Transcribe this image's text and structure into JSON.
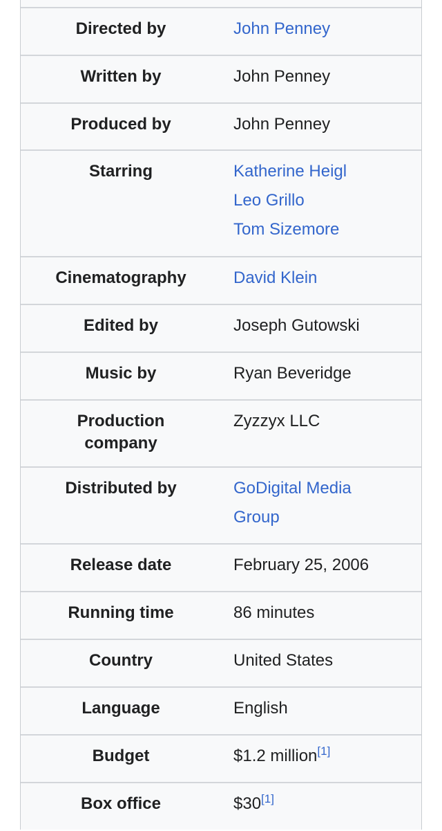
{
  "infobox": {
    "rows": [
      {
        "label": "Directed by",
        "values": [
          {
            "text": "John Penney",
            "link": true
          }
        ]
      },
      {
        "label": "Written by",
        "values": [
          {
            "text": "John Penney",
            "link": false
          }
        ]
      },
      {
        "label": "Produced by",
        "values": [
          {
            "text": "John Penney",
            "link": false
          }
        ]
      },
      {
        "label": "Starring",
        "values": [
          {
            "text": "Katherine Heigl",
            "link": true
          },
          {
            "text": "Leo Grillo",
            "link": true
          },
          {
            "text": "Tom Sizemore",
            "link": true
          }
        ]
      },
      {
        "label": "Cinematography",
        "values": [
          {
            "text": "David Klein",
            "link": true
          }
        ]
      },
      {
        "label": "Edited by",
        "values": [
          {
            "text": "Joseph Gutowski",
            "link": false
          }
        ]
      },
      {
        "label": "Music by",
        "values": [
          {
            "text": "Ryan Beveridge",
            "link": false
          }
        ]
      },
      {
        "label_line1": "Production",
        "label_line2": "company",
        "values": [
          {
            "text": "Zyzzyx LLC",
            "link": false
          }
        ]
      },
      {
        "label": "Distributed by",
        "values": [
          {
            "text": "GoDigital Media",
            "link": true
          },
          {
            "text": "Group",
            "link": true
          }
        ]
      },
      {
        "label": "Release date",
        "values": [
          {
            "text": "February 25, 2006",
            "link": false
          }
        ]
      },
      {
        "label": "Running time",
        "values": [
          {
            "text": "86 minutes",
            "link": false
          }
        ]
      },
      {
        "label": "Country",
        "values": [
          {
            "text": "United States",
            "link": false
          }
        ]
      },
      {
        "label": "Language",
        "values": [
          {
            "text": "English",
            "link": false
          }
        ]
      },
      {
        "label": "Budget",
        "values": [
          {
            "text": "$1.2 million",
            "link": false,
            "ref": "[1]"
          }
        ]
      },
      {
        "label": "Box office",
        "values": [
          {
            "text": "$30",
            "link": false,
            "ref": "[1]"
          }
        ]
      }
    ]
  }
}
